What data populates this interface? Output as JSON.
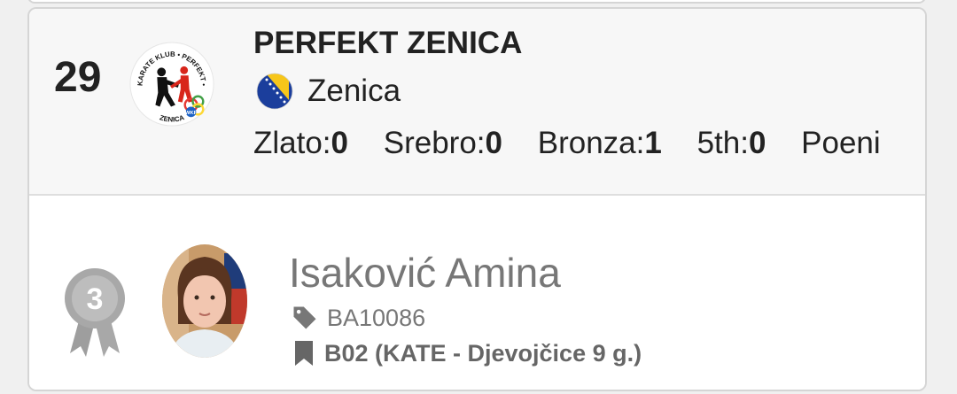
{
  "club": {
    "rank": "29",
    "logo": {
      "icon": "karate-club-perfekt-logo",
      "text_top": "KARATE KLUB • PERFEKT •",
      "text_bottom": "ZENICA",
      "badge": "WKF"
    },
    "name": "PERFEKT ZENICA",
    "flag_icon": "bosnia-herzegovina-flag-icon",
    "city": "Zenica",
    "medals": [
      {
        "label": "Zlato:",
        "value": "0"
      },
      {
        "label": "Srebro:",
        "value": "0"
      },
      {
        "label": "Bronza:",
        "value": "1"
      },
      {
        "label": "5th:",
        "value": "0"
      },
      {
        "label": "Poeni",
        "value": ""
      }
    ]
  },
  "athlete": {
    "place": "3",
    "place_icon": "bronze-medal-ribbon-icon",
    "avatar": "athlete-photo",
    "name": "Isaković Amina",
    "tag_icon": "tag-icon",
    "id": "BA10086",
    "bookmark_icon": "bookmark-icon",
    "category": "B02 (KATE - Djevojčice 9 g.)"
  },
  "colors": {
    "card_border": "#d5d5d5",
    "header_bg": "#f7f7f7",
    "text_dark": "#222222",
    "text_muted": "#777777",
    "medal_bronze_grey": "#9e9e9e"
  }
}
